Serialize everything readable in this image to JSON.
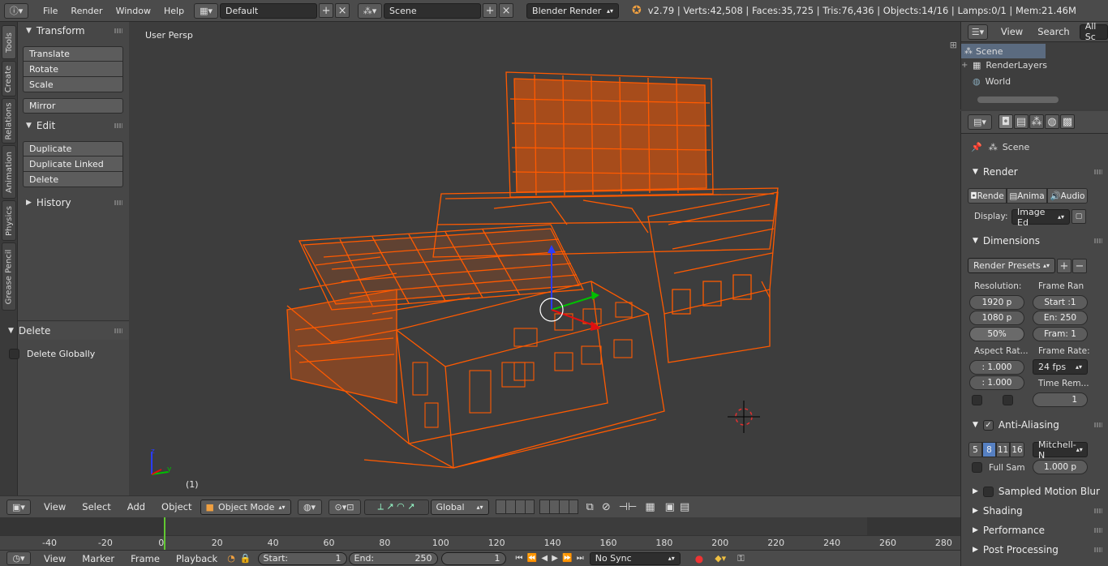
{
  "topbar": {
    "menus": [
      "File",
      "Render",
      "Window",
      "Help"
    ],
    "layout": "Default",
    "scene": "Scene",
    "engine": "Blender Render",
    "stats": "v2.79 | Verts:42,508 | Faces:35,725 | Tris:76,436 | Objects:14/16 | Lamps:0/1 | Mem:21.46M"
  },
  "tabs": [
    "Tools",
    "Create",
    "Relations",
    "Animation",
    "Physics",
    "Grease Pencil"
  ],
  "toolshelf": {
    "transform": {
      "title": "Transform",
      "buttons": [
        "Translate",
        "Rotate",
        "Scale",
        "Mirror"
      ]
    },
    "edit": {
      "title": "Edit",
      "buttons": [
        "Duplicate",
        "Duplicate Linked",
        "Delete"
      ]
    },
    "history": {
      "title": "History"
    },
    "operator": {
      "title": "Delete",
      "option": "Delete Globally"
    }
  },
  "viewport": {
    "view_name": "User Persp",
    "frame_label": "(1)",
    "wire_color": "#ff5a00"
  },
  "vp_header": {
    "menus": [
      "View",
      "Select",
      "Add",
      "Object"
    ],
    "mode": "Object Mode",
    "orientation": "Global"
  },
  "timeline": {
    "ticks": [
      "-40",
      "-20",
      "0",
      "20",
      "40",
      "60",
      "80",
      "100",
      "120",
      "140",
      "160",
      "180",
      "200",
      "220",
      "240",
      "260",
      "280"
    ],
    "current_frame": 1,
    "menus": [
      "View",
      "Marker",
      "Frame",
      "Playback"
    ],
    "start_label": "Start:",
    "start_value": "1",
    "end_label": "End:",
    "end_value": "250",
    "frame_value": "1",
    "sync": "No Sync"
  },
  "outliner": {
    "menus": [
      "View",
      "Search"
    ],
    "filter": "All Sc",
    "items": [
      "Scene",
      "RenderLayers",
      "World"
    ]
  },
  "properties": {
    "context": "Scene",
    "render": {
      "title": "Render",
      "buttons": [
        "Rende",
        "Anima",
        "Audio"
      ],
      "display_label": "Display:",
      "display_value": "Image Ed"
    },
    "dimensions": {
      "title": "Dimensions",
      "presets": "Render Presets",
      "resolution_label": "Resolution:",
      "res_x": "1920 p",
      "res_y": "1080 p",
      "res_pct": "50%",
      "frame_range_label": "Frame Ran",
      "start": "Start :1",
      "end": "En: 250",
      "step": "Fram: 1",
      "aspect_label": "Aspect Rat...",
      "aspect_x": ": 1.000",
      "aspect_y": ": 1.000",
      "frame_rate_label": "Frame Rate:",
      "fps": "24 fps",
      "time_remap_label": "Time Rem...",
      "time_remap_value": "1"
    },
    "aa": {
      "title": "Anti-Aliasing",
      "samples": [
        "5",
        "8",
        "11",
        "16"
      ],
      "selected_sample": "8",
      "filter": "Mitchell-N",
      "full_sample": "Full Sam",
      "filter_size": "1.000 p"
    },
    "collapsed": [
      "Sampled Motion Blur",
      "Shading",
      "Performance",
      "Post Processing"
    ]
  }
}
